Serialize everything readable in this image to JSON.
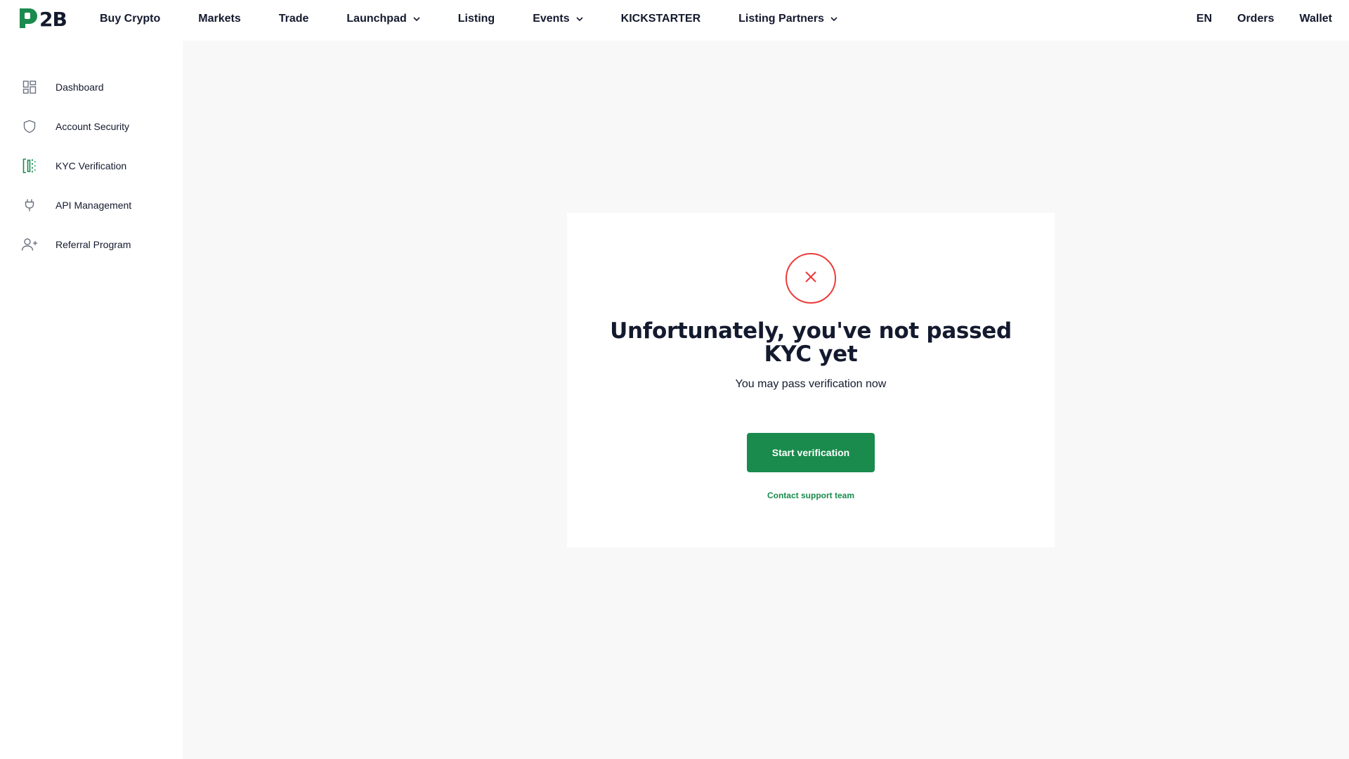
{
  "header": {
    "logo": {
      "prefix_icon": "p-logo-icon",
      "text": "2B",
      "brand_color": "#1a8b4d"
    },
    "nav": [
      {
        "label": "Buy Crypto",
        "dropdown": false
      },
      {
        "label": "Markets",
        "dropdown": false
      },
      {
        "label": "Trade",
        "dropdown": false
      },
      {
        "label": "Launchpad",
        "dropdown": true
      },
      {
        "label": "Listing",
        "dropdown": false
      },
      {
        "label": "Events",
        "dropdown": true
      },
      {
        "label": "KICKSTARTER",
        "dropdown": false
      },
      {
        "label": "Listing Partners",
        "dropdown": true
      }
    ],
    "right": {
      "language": "EN",
      "orders": "Orders",
      "wallet": "Wallet"
    }
  },
  "sidebar": {
    "items": [
      {
        "label": "Dashboard",
        "icon": "dashboard-grid-icon",
        "active": false
      },
      {
        "label": "Account Security",
        "icon": "shield-icon",
        "active": false
      },
      {
        "label": "KYC Verification",
        "icon": "id-scan-icon",
        "active": true
      },
      {
        "label": "API Management",
        "icon": "plug-icon",
        "active": false
      },
      {
        "label": "Referral Program",
        "icon": "user-plus-icon",
        "active": false
      }
    ]
  },
  "kyc_card": {
    "status_icon": "close-icon",
    "status_color": "#eb3b3b",
    "title": "Unfortunately, you've not passed KYC yet",
    "subtitle": "You may pass verification now",
    "start_button": "Start verification",
    "support_link": "Contact support team",
    "accent_color": "#1a8b4d"
  }
}
